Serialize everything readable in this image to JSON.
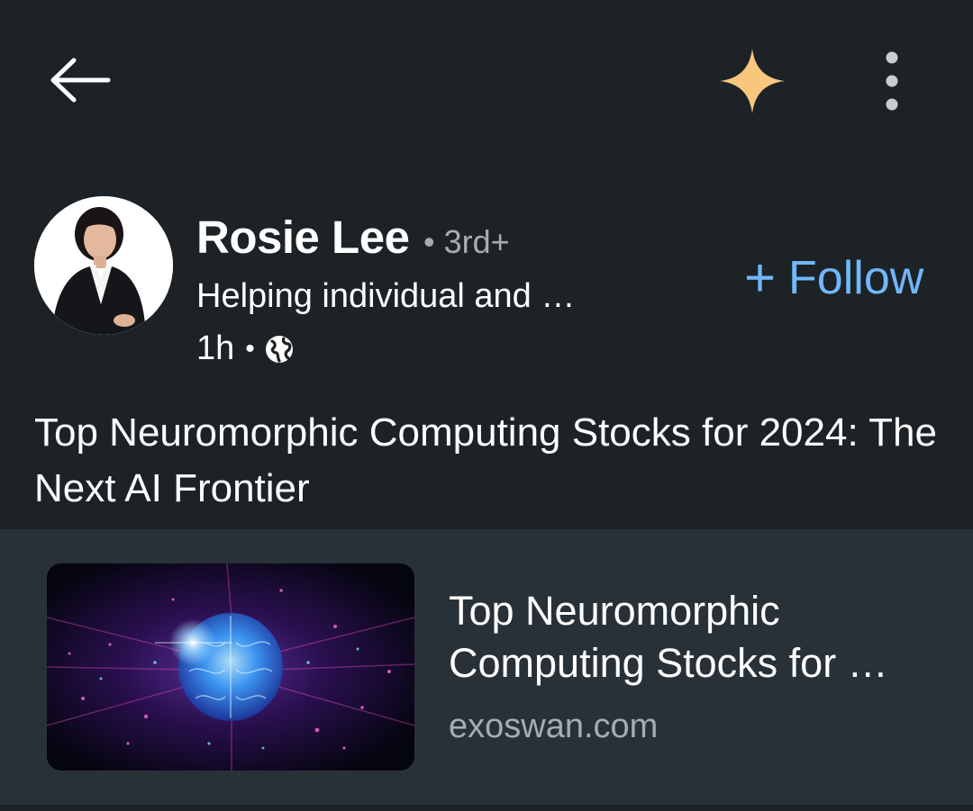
{
  "topbar": {
    "back_icon": "arrow-left-icon",
    "ai_icon": "sparkle-icon",
    "more_icon": "more-vertical-icon",
    "accent": "#f8c77e"
  },
  "post": {
    "author": {
      "name": "Rosie Lee",
      "degree": "• 3rd+",
      "headline": "Helping individual and …",
      "time": "1h",
      "separator": "•",
      "visibility_icon": "globe-icon"
    },
    "follow": {
      "plus": "+",
      "label": "Follow",
      "color": "#71b7fb"
    },
    "text": "Top Neuromorphic Computing Stocks for 2024: The Next AI Frontier"
  },
  "link_card": {
    "title": "Top Neuromorphic Computing Stocks for …",
    "domain": "exoswan.com",
    "thumbnail": "glowing-brain-image"
  }
}
